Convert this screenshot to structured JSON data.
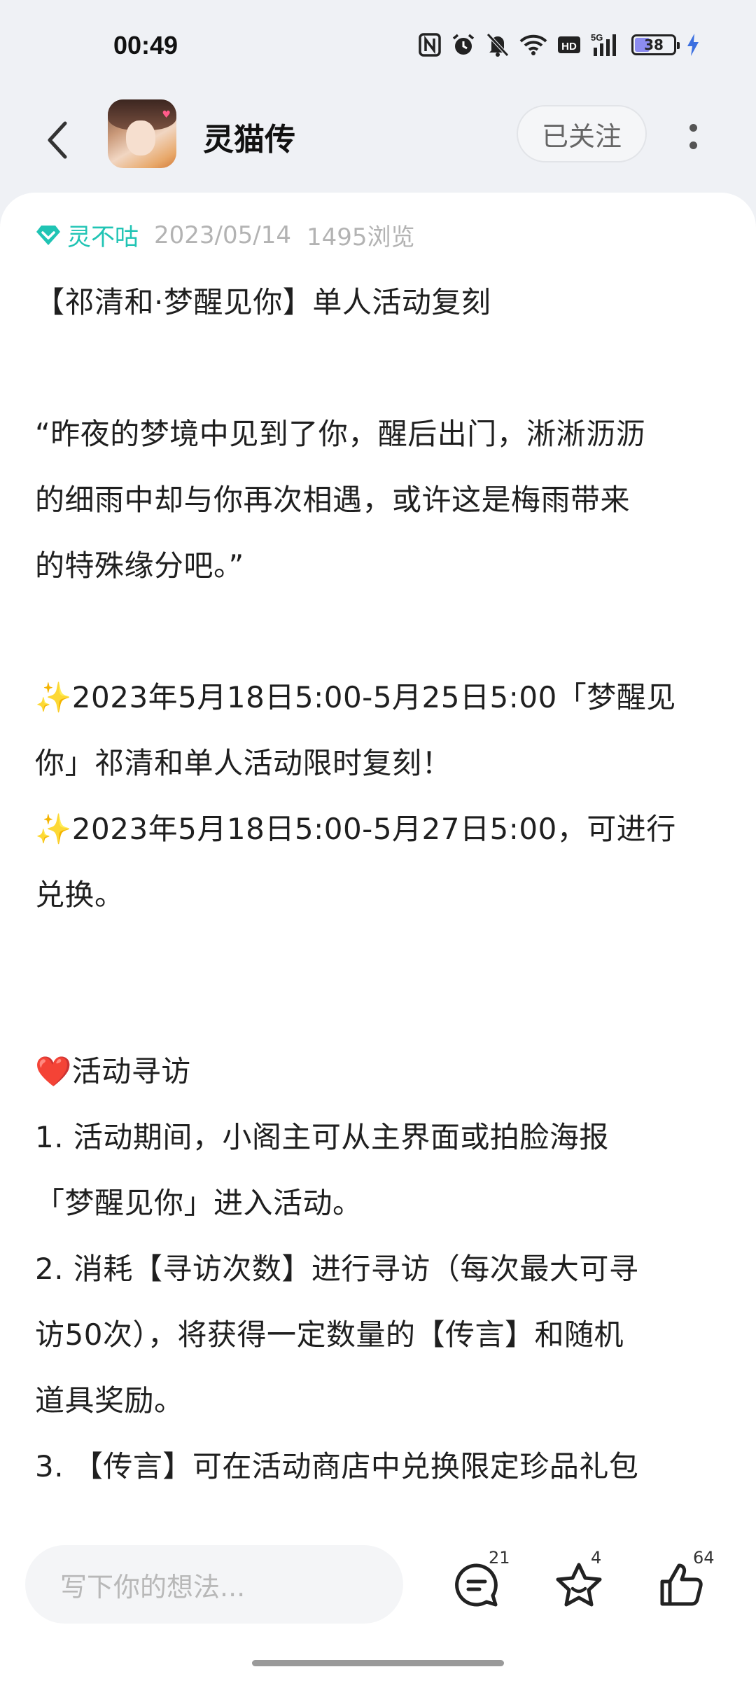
{
  "status_bar": {
    "time": "00:49",
    "battery_level": "38",
    "icons": [
      "nfc-icon",
      "alarm-icon",
      "mute-icon",
      "wifi-icon",
      "hd-icon",
      "signal-5g-icon",
      "battery-icon",
      "charging-icon"
    ]
  },
  "header": {
    "title": "灵猫传",
    "follow_label": "已关注"
  },
  "post": {
    "author": "灵不咕",
    "date": "2023/05/14",
    "views": "1495浏览",
    "title_line": "【祁清和·梦醒见你】单人活动复刻",
    "quote_lines": [
      "“昨夜的梦境中见到了你，醒后出门，淅淅沥沥",
      "的细雨中却与你再次相遇，或许这是梅雨带来",
      "的特殊缘分吧。”"
    ],
    "sparkle1_lines": [
      "✨2023年5月18日5:00-5月25日5:00「梦醒见",
      "你」祁清和单人活动限时复刻！"
    ],
    "sparkle2_lines": [
      "✨2023年5月18日5:00-5月27日5:00，可进行",
      "兑换。"
    ],
    "section_title": "❤️活动寻访",
    "item1_lines": [
      "1. 活动期间，小阁主可从主界面或拍脸海报",
      "「梦醒见你」进入活动。"
    ],
    "item2_lines": [
      "2. 消耗【寻访次数】进行寻访（每次最大可寻",
      "访50次），将获得一定数量的【传言】和随机",
      "道具奖励。"
    ],
    "item3_partial": "3. 【传言】可在活动商店中兑换限定珍品礼包"
  },
  "bottom_bar": {
    "comment_placeholder": "写下你的想法...",
    "comment_count": "21",
    "favorite_count": "4",
    "like_count": "64"
  },
  "colors": {
    "accent": "#20c4b4",
    "background": "#eff1f5"
  }
}
